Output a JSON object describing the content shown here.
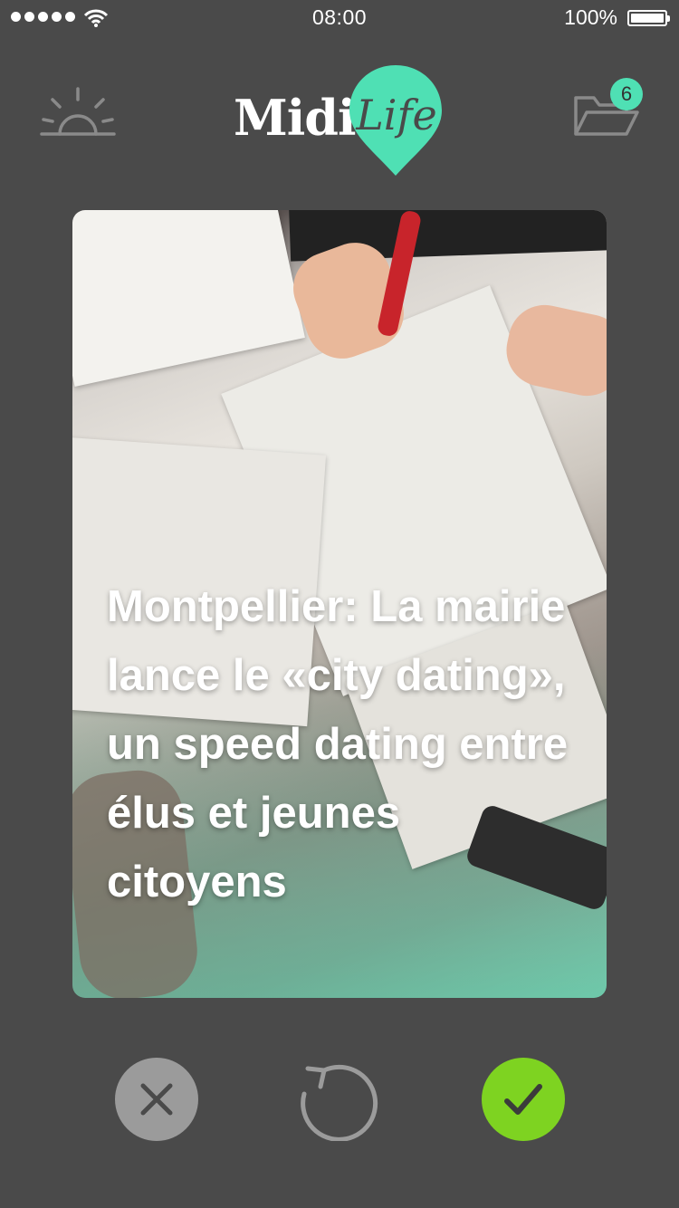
{
  "status_bar": {
    "time": "08:00",
    "battery_percent": "100%",
    "battery_level": 1.0,
    "signal_bars": 5
  },
  "header": {
    "logo_text_1": "Midi",
    "logo_text_2": "Life",
    "brand_color": "#4fe0b4",
    "left_icon": "sunrise-icon",
    "right_icon": "folder-icon",
    "folder_badge_count": "6"
  },
  "card": {
    "title": "Montpellier: La mairie lance le «city dating», un speed dating entre élus et jeunes citoyens"
  },
  "actions": {
    "reject_icon": "close-icon",
    "undo_icon": "undo-icon",
    "accept_icon": "check-icon",
    "reject_color": "#9b9b9b",
    "accept_color": "#7ed321"
  }
}
